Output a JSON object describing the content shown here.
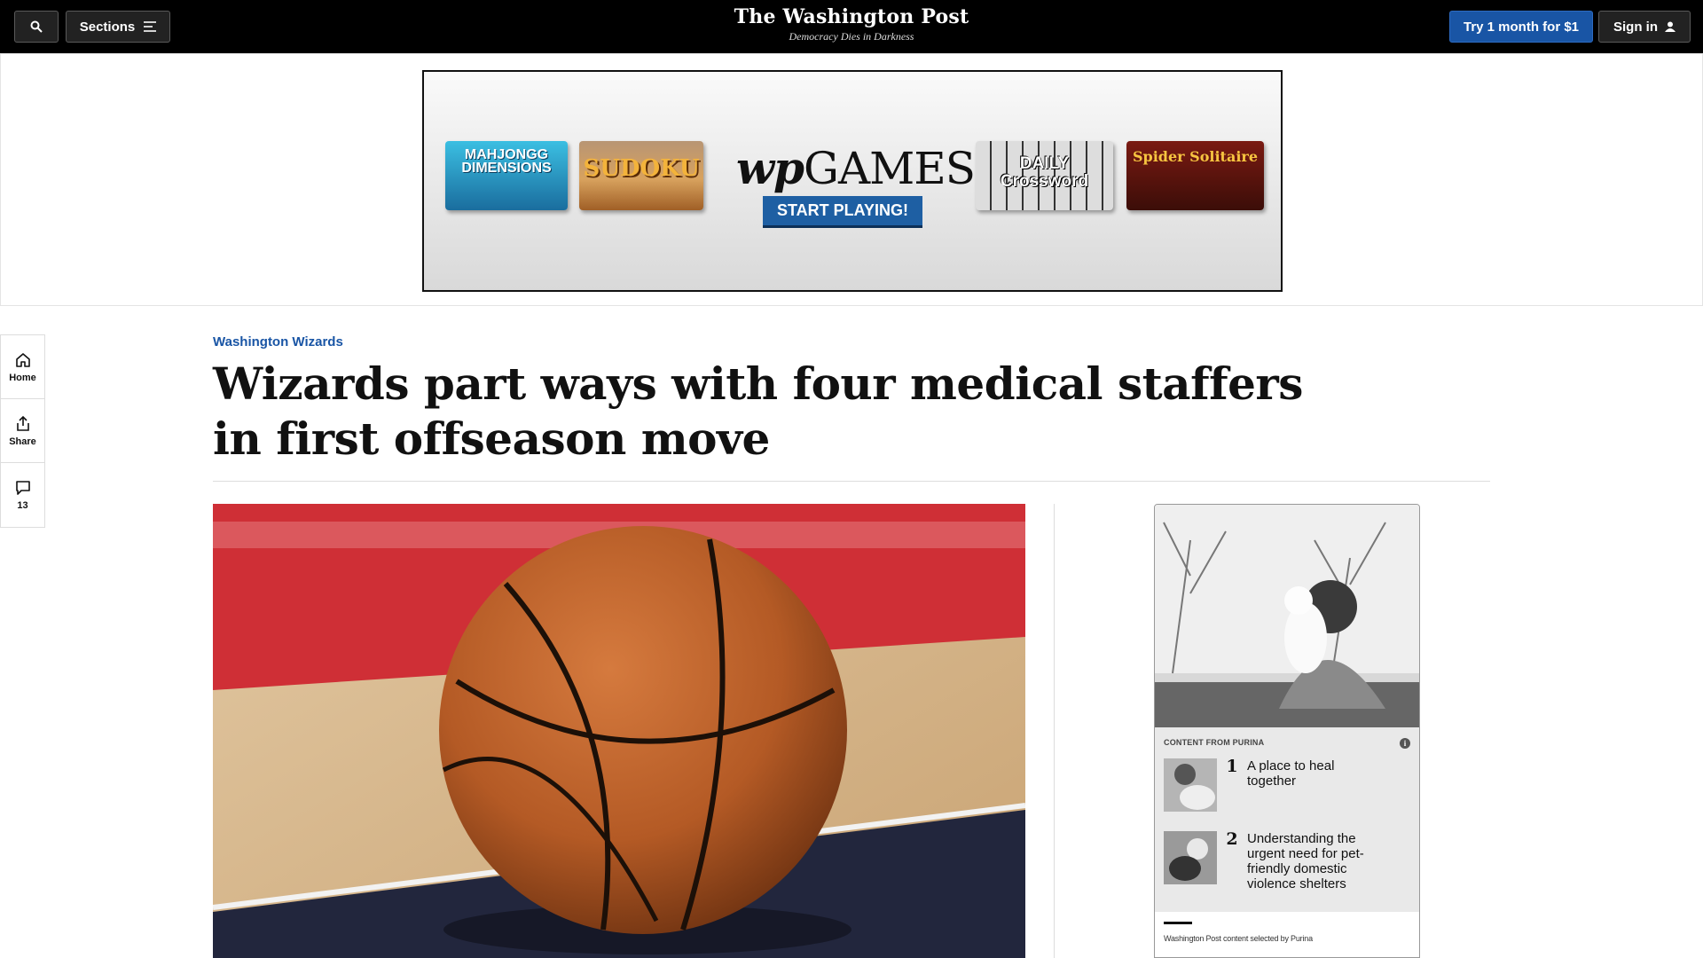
{
  "header": {
    "sections_label": "Sections",
    "logo": "The Washington Post",
    "tagline": "Democracy Dies in Darkness",
    "subscribe_label": "Try 1 month for $1",
    "signin_label": "Sign in"
  },
  "ad": {
    "tiles": [
      "MAHJONGG DIMENSIONS",
      "SUDOKU",
      "DAILY Crossword",
      "Spider Solitaire"
    ],
    "brand_wp": "wp",
    "brand_games": "GAMES",
    "cta": "START PLAYING!"
  },
  "rail": {
    "home_label": "Home",
    "share_label": "Share",
    "comments_count": "13"
  },
  "article": {
    "kicker": "Washington Wizards",
    "headline": "Wizards part ways with four medical staffers in first offseason move"
  },
  "sponsor": {
    "label": "CONTENT FROM PURINA",
    "items": [
      {
        "num": "1",
        "title": "A place to heal together"
      },
      {
        "num": "2",
        "title": "Understanding the urgent need for pet-friendly domestic violence shelters"
      }
    ],
    "footer": "Washington Post content selected by Purina"
  },
  "colors": {
    "accent_blue": "#1955a5",
    "top_bar": "#000000"
  }
}
